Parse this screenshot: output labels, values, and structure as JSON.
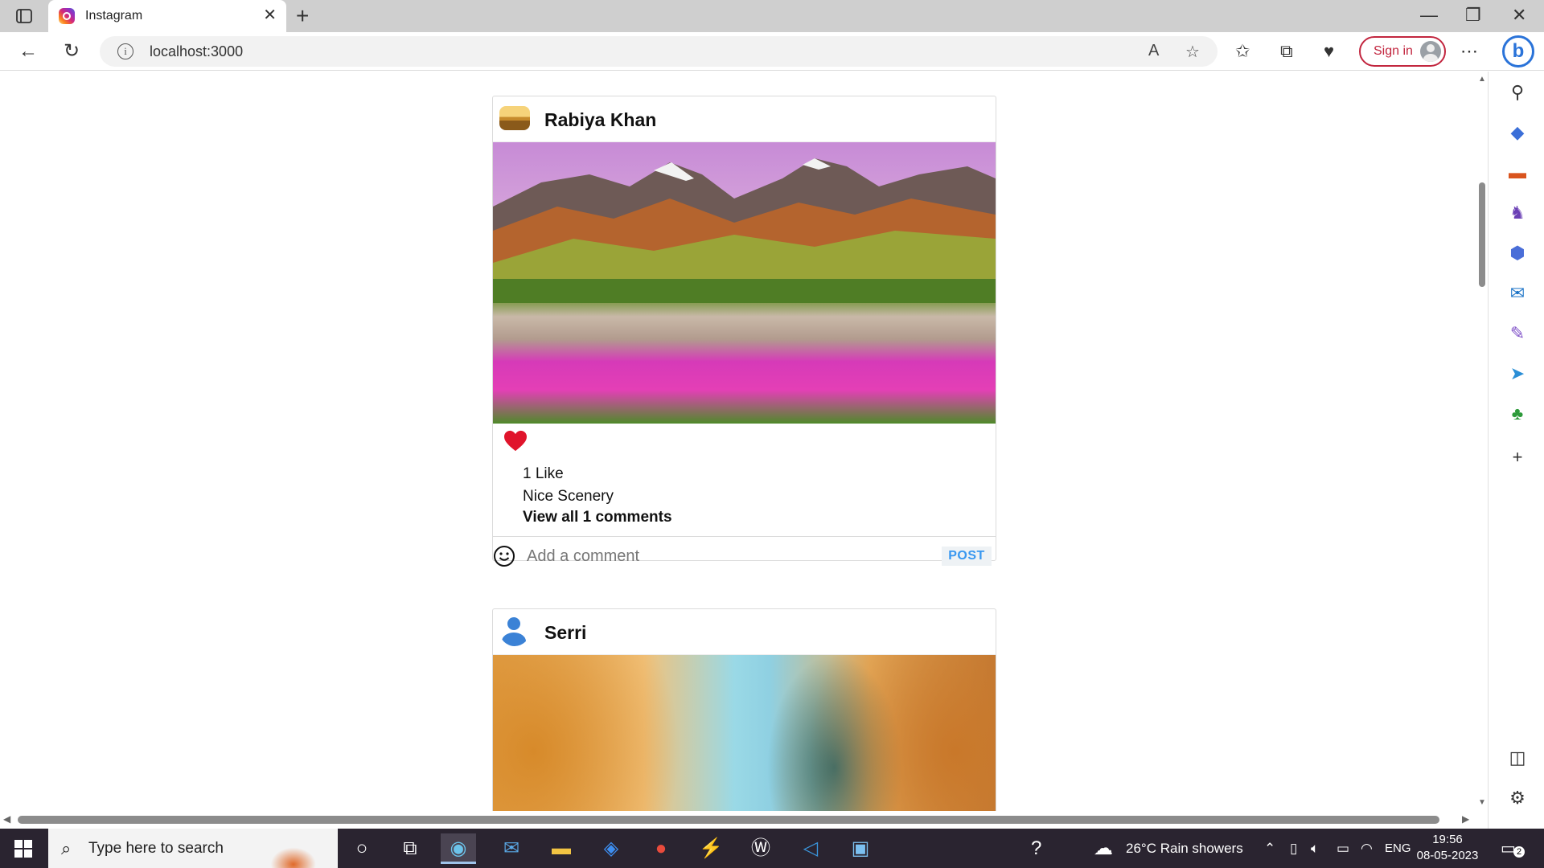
{
  "browser": {
    "tab_title": "Instagram",
    "tab_close": "✕",
    "new_tab": "+",
    "url": "localhost:3000",
    "sign_in": "Sign in",
    "window_controls": [
      "—",
      "❐",
      "✕"
    ]
  },
  "posts": [
    {
      "username": "Rabiya Khan",
      "avatar_icon": "landscape-avatar-icon",
      "image": "mountain-flower-field",
      "liked": true,
      "likes_text": "1 Like",
      "caption": "Nice Scenery",
      "view_comments": "View all 1 comments",
      "comment_placeholder": "Add a comment",
      "post_label": "POST"
    },
    {
      "username": "Serri",
      "avatar_icon": "default-user-icon",
      "image": "autumn-trees"
    }
  ],
  "taskbar": {
    "search_placeholder": "Type here to search",
    "weather": "26°C  Rain showers",
    "language": "ENG",
    "time": "19:56",
    "date": "08-05-2023",
    "notifications": "2"
  },
  "colors": {
    "heart": "#e0142b",
    "post_button": "#3897f0",
    "signin_border": "#c2263f",
    "taskbar": "#2a2430"
  }
}
